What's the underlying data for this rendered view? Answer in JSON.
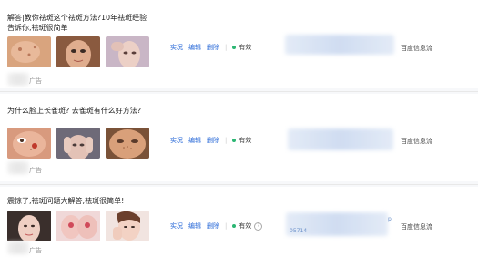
{
  "rows": [
    {
      "title": "解答|教你祛斑这个祛斑方法?10年祛斑经验告诉你,祛斑很简单",
      "ad_label": "广告",
      "actions": {
        "preview": "实况",
        "edit": "编辑",
        "delete": "删除"
      },
      "status": "有效",
      "campaign": "百度信息流",
      "thumbs": [
        "face-skin-closeup",
        "woman-face",
        "woman-touching-forehead"
      ]
    },
    {
      "title": "为什么脸上长雀斑? 去雀斑有什么好方法?",
      "ad_label": "广告",
      "actions": {
        "preview": "实况",
        "edit": "编辑",
        "delete": "删除"
      },
      "status": "有效",
      "campaign": "百度信息流",
      "thumbs": [
        "face-eye-closeup",
        "woman-face-hands",
        "freckled-face"
      ]
    },
    {
      "title": "震惊了,祛斑问题大解答,祛斑很简单!",
      "ad_label": "广告",
      "actions": {
        "preview": "实况",
        "edit": "编辑",
        "delete": "删除"
      },
      "status": "有效",
      "campaign": "百度信息流",
      "id_fragment": "05714",
      "id_suffix": "p",
      "thumbs": [
        "woman-portrait",
        "skin-treatment",
        "woman-smiling-hand"
      ]
    }
  ],
  "colors": {
    "link": "#2a6ad8",
    "status_dot": "#2bb673",
    "text": "#222222"
  }
}
